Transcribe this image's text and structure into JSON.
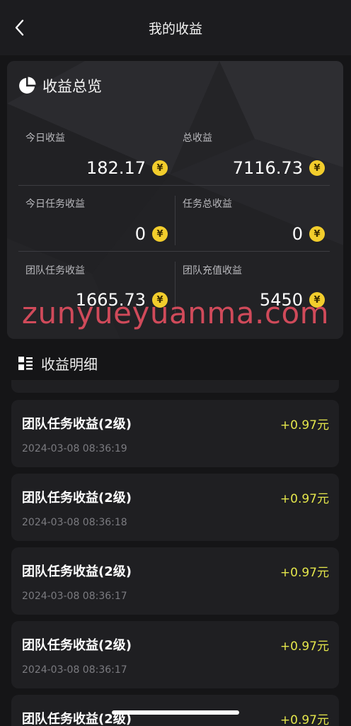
{
  "header": {
    "title": "我的收益"
  },
  "overview": {
    "title": "收益总览",
    "stats": [
      {
        "label": "今日收益",
        "value": "182.17"
      },
      {
        "label": "总收益",
        "value": "7116.73"
      },
      {
        "label": "今日任务收益",
        "value": "0"
      },
      {
        "label": "任务总收益",
        "value": "0"
      },
      {
        "label": "团队任务收益",
        "value": "1665.73"
      },
      {
        "label": "团队充值收益",
        "value": "5450"
      }
    ],
    "currency_symbol": "¥"
  },
  "detail": {
    "title": "收益明细",
    "records": [
      {
        "title": "团队任务收益(2级)",
        "amount": "+0.97元",
        "time": "2024-03-08 08:36:19"
      },
      {
        "title": "团队任务收益(2级)",
        "amount": "+0.97元",
        "time": "2024-03-08 08:36:18"
      },
      {
        "title": "团队任务收益(2级)",
        "amount": "+0.97元",
        "time": "2024-03-08 08:36:17"
      },
      {
        "title": "团队任务收益(2级)",
        "amount": "+0.97元",
        "time": "2024-03-08 08:36:17"
      },
      {
        "title": "团队任务收益(2级)",
        "amount": "+0.97元"
      }
    ]
  },
  "watermark": "zunyueyuanma.com",
  "colors": {
    "background": "#151517",
    "card": "#1f1f22",
    "amount": "#e4e64b",
    "coin": "#f2cd2c",
    "watermark": "#e85062"
  },
  "icons": {
    "back": "chevron-left-icon",
    "overview": "pie-chart-icon",
    "detail": "list-icon",
    "coin": "yen-coin-icon"
  }
}
